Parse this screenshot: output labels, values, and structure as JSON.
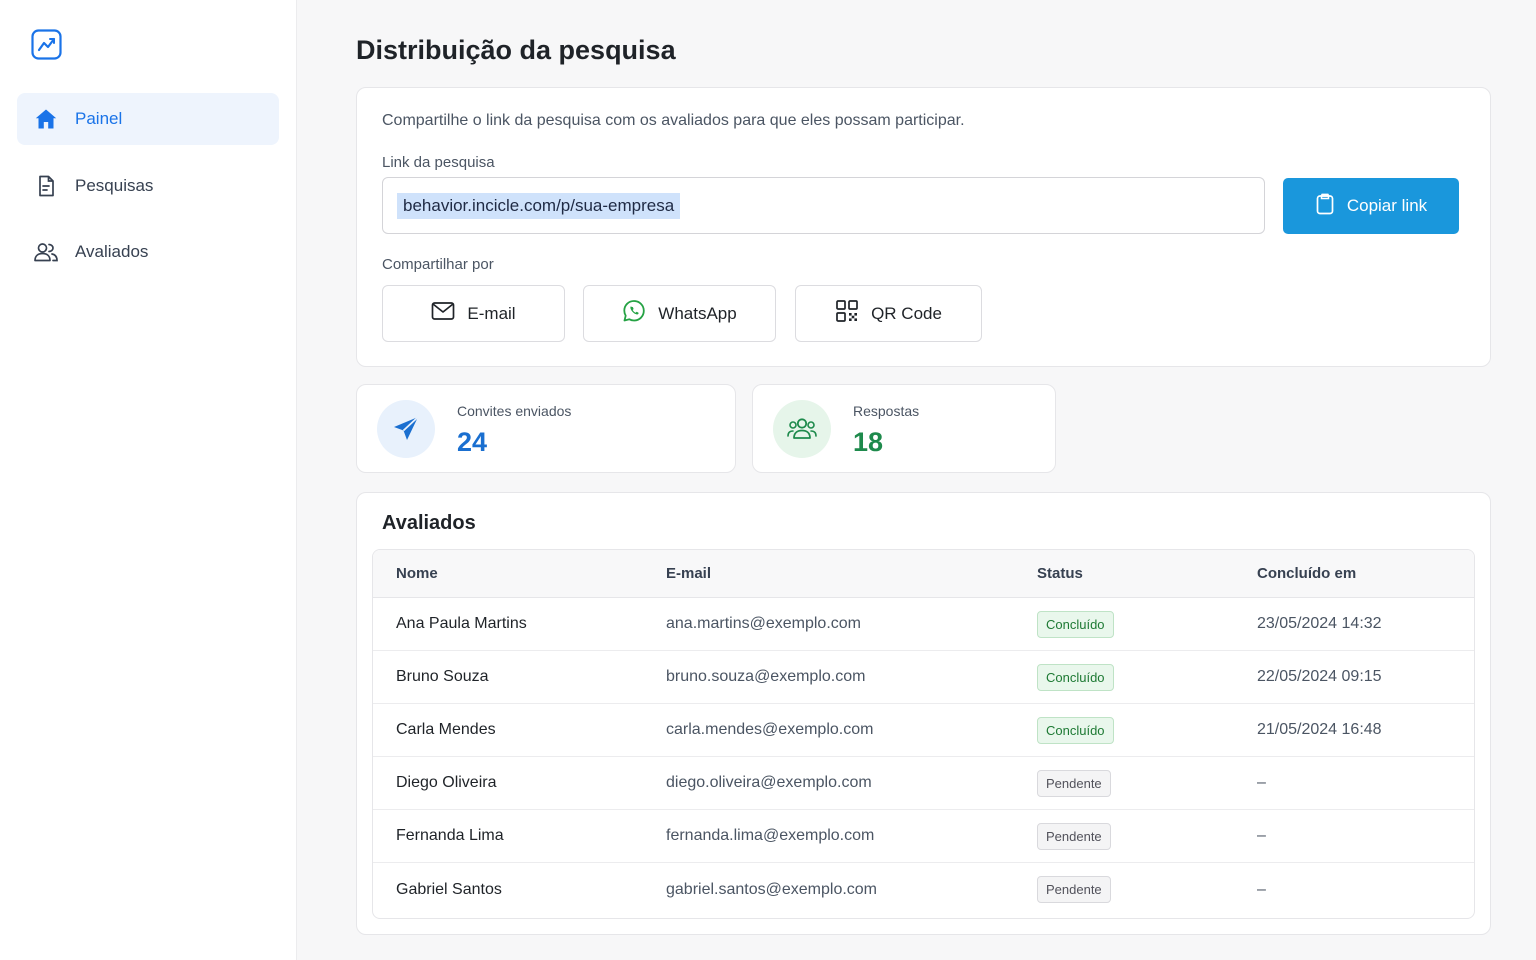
{
  "sidebar": {
    "items": [
      {
        "label": "Painel",
        "icon": "home-icon",
        "active": true
      },
      {
        "label": "Pesquisas",
        "icon": "document-icon",
        "active": false
      },
      {
        "label": "Avaliados",
        "icon": "users-icon",
        "active": false
      }
    ]
  },
  "page": {
    "title": "Distribuição da pesquisa"
  },
  "share": {
    "description": "Compartilhe o link da pesquisa com os avaliados para que eles possam participar.",
    "link_label": "Link da pesquisa",
    "link_value": "behavior.incicle.com/p/sua-empresa",
    "copy_label": "Copiar link",
    "share_by_label": "Compartilhar por",
    "buttons": [
      {
        "label": "E-mail",
        "icon": "mail-icon"
      },
      {
        "label": "WhatsApp",
        "icon": "whatsapp-icon"
      },
      {
        "label": "QR Code",
        "icon": "qr-code-icon"
      }
    ]
  },
  "stats": [
    {
      "label": "Convites enviados",
      "value": "24",
      "icon": "send-icon",
      "color": "#1a6fd0"
    },
    {
      "label": "Respostas",
      "value": "18",
      "icon": "users-icon",
      "color": "#1e8a4c"
    }
  ],
  "table": {
    "title": "Avaliados",
    "columns": [
      "Nome",
      "E-mail",
      "Status",
      "Concluído em"
    ],
    "rows": [
      {
        "name": "Ana Paula Martins",
        "email": "ana.martins@exemplo.com",
        "status": "Concluído",
        "date": "23/05/2024 14:32"
      },
      {
        "name": "Bruno Souza",
        "email": "bruno.souza@exemplo.com",
        "status": "Concluído",
        "date": "22/05/2024 09:15"
      },
      {
        "name": "Carla Mendes",
        "email": "carla.mendes@exemplo.com",
        "status": "Concluído",
        "date": "21/05/2024 16:48"
      },
      {
        "name": "Diego Oliveira",
        "email": "diego.oliveira@exemplo.com",
        "status": "Pendente",
        "date": "–"
      },
      {
        "name": "Fernanda Lima",
        "email": "fernanda.lima@exemplo.com",
        "status": "Pendente",
        "date": "–"
      },
      {
        "name": "Gabriel Santos",
        "email": "gabriel.santos@exemplo.com",
        "status": "Pendente",
        "date": "–"
      }
    ]
  },
  "colors": {
    "accent": "#1a97dc",
    "nav_active": "#1a73e8",
    "success": "#1e7a34"
  }
}
